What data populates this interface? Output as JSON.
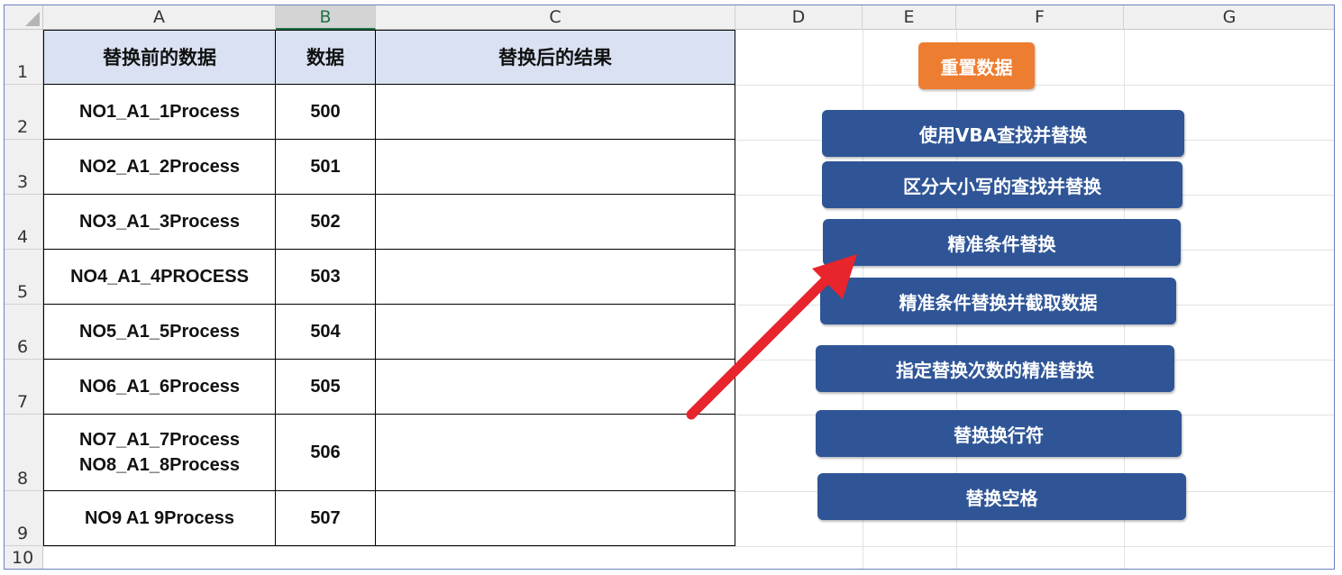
{
  "columns": [
    "A",
    "B",
    "C",
    "D",
    "E",
    "F",
    "G"
  ],
  "rows": [
    "1",
    "2",
    "3",
    "4",
    "5",
    "6",
    "7",
    "8",
    "9",
    "10"
  ],
  "table": {
    "headers": [
      "替换前的数据",
      "数据",
      "替换后的结果"
    ],
    "rows": [
      {
        "a": "NO1_A1_1Process",
        "b": "500",
        "c": ""
      },
      {
        "a": "NO2_A1_2Process",
        "b": "501",
        "c": ""
      },
      {
        "a": "NO3_A1_3Process",
        "b": "502",
        "c": ""
      },
      {
        "a": "NO4_A1_4PROCESS",
        "b": "503",
        "c": ""
      },
      {
        "a": "NO5_A1_5Process",
        "b": "504",
        "c": ""
      },
      {
        "a": "NO6_A1_6Process",
        "b": "505",
        "c": ""
      },
      {
        "a": "NO7_A1_7Process\nNO8_A1_8Process",
        "b": "506",
        "c": ""
      },
      {
        "a": "NO9 A1 9Process",
        "b": "507",
        "c": ""
      }
    ]
  },
  "buttons": {
    "reset": "重置数据",
    "vba_find_replace": "使用VBA查找并替换",
    "case_sensitive": "区分大小写的查找并替换",
    "exact_replace": "精准条件替换",
    "exact_replace_extract": "精准条件替换并截取数据",
    "replace_count": "指定替换次数的精准替换",
    "replace_newline": "替换换行符",
    "replace_space": "替换空格"
  },
  "colors": {
    "button_blue": "#2f5597",
    "button_orange": "#ed7d31",
    "header_fill": "#d9e1f2",
    "arrow_red": "#e8242c",
    "selected_column": "#217346"
  },
  "selected_column": "B"
}
